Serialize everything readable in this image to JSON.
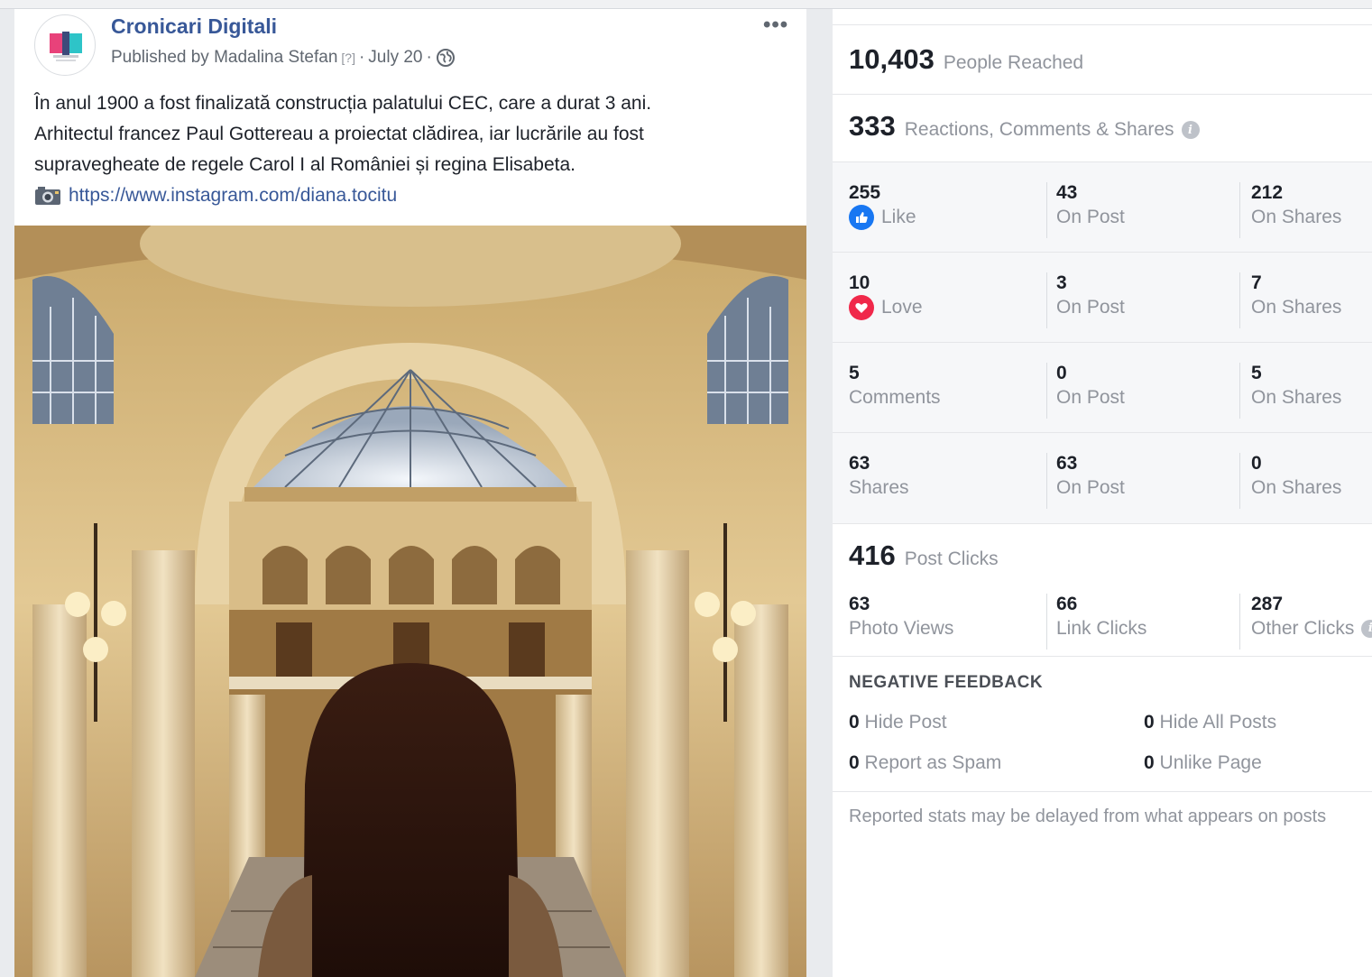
{
  "post": {
    "page_name": "Cronicari Digitali",
    "byline_prefix": "Published by Madalina Stefan",
    "byline_help": "[?]",
    "byline_sep1": "·",
    "date": "July 20",
    "byline_sep2": "·",
    "more_label": "•••",
    "text_line1": "În anul 1900 a fost finalizată construcția palatului CEC, care a durat 3 ani.",
    "text_line2": "Arhitectul francez Paul Gottereau a proiectat clădirea, iar lucrările au fost",
    "text_line3": "supravegheate de regele Carol I al României și regina Elisabeta.",
    "link": "https://www.instagram.com/diana.tocitu"
  },
  "insights": {
    "reach": {
      "value": "10,403",
      "label": "People Reached"
    },
    "engagement": {
      "value": "333",
      "label": "Reactions, Comments & Shares"
    },
    "rows": [
      {
        "total": "255",
        "label": "Like",
        "icon": "like-icon",
        "on_post": "43",
        "on_post_label": "On Post",
        "on_shares": "212",
        "on_shares_label": "On Shares"
      },
      {
        "total": "10",
        "label": "Love",
        "icon": "love-icon",
        "on_post": "3",
        "on_post_label": "On Post",
        "on_shares": "7",
        "on_shares_label": "On Shares"
      },
      {
        "total": "5",
        "label": "Comments",
        "on_post": "0",
        "on_post_label": "On Post",
        "on_shares": "5",
        "on_shares_label": "On Shares"
      },
      {
        "total": "63",
        "label": "Shares",
        "on_post": "63",
        "on_post_label": "On Post",
        "on_shares": "0",
        "on_shares_label": "On Shares"
      }
    ],
    "clicks": {
      "value": "416",
      "label": "Post Clicks",
      "photo_views": "63",
      "photo_views_label": "Photo Views",
      "link_clicks": "66",
      "link_clicks_label": "Link Clicks",
      "other_clicks": "287",
      "other_clicks_label": "Other Clicks"
    },
    "negative": {
      "title": "NEGATIVE FEEDBACK",
      "hide_post": "0",
      "hide_post_label": "Hide Post",
      "hide_all": "0",
      "hide_all_label": "Hide All Posts",
      "spam": "0",
      "spam_label": "Report as Spam",
      "unlike": "0",
      "unlike_label": "Unlike Page"
    },
    "note": "Reported stats may be delayed from what appears on posts"
  },
  "colors": {
    "link": "#385898",
    "like": "#1877f2",
    "love": "#f0284a",
    "muted": "#90949c"
  }
}
